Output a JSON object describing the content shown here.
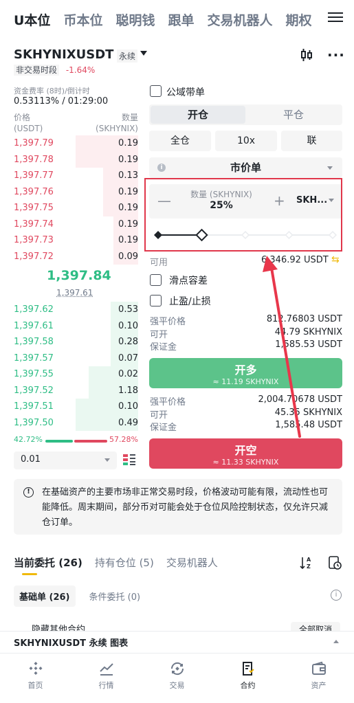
{
  "top_nav": {
    "tabs": [
      "U本位",
      "币本位",
      "聪明钱",
      "跟单",
      "交易机器人",
      "期权"
    ],
    "active": 0
  },
  "header": {
    "symbol": "SKHYNIXUSDT",
    "tag": "永续",
    "session": "非交易时段",
    "change": "-1.64%"
  },
  "orderbook": {
    "funding_label": "资金费率 (8时)/倒计时",
    "funding_value": "0.53113% / 01:29:00",
    "price_header": "价格",
    "price_unit": "(USDT)",
    "qty_header": "数量",
    "qty_unit": "(SKHYNIX)",
    "asks": [
      {
        "price": "1,397.79",
        "qty": "0.19",
        "depth": 0.5
      },
      {
        "price": "1,397.78",
        "qty": "0.19",
        "depth": 0.5
      },
      {
        "price": "1,397.77",
        "qty": "0.13",
        "depth": 0.28
      },
      {
        "price": "1,397.76",
        "qty": "0.19",
        "depth": 0.28
      },
      {
        "price": "1,397.75",
        "qty": "0.19",
        "depth": 0.28
      },
      {
        "price": "1,397.74",
        "qty": "0.19",
        "depth": 0.2
      },
      {
        "price": "1,397.73",
        "qty": "0.19",
        "depth": 0.2
      },
      {
        "price": "1,397.72",
        "qty": "0.09",
        "depth": 0.2
      }
    ],
    "last_price": "1,397.84",
    "mark_price": "1,397.61",
    "bids": [
      {
        "price": "1,397.62",
        "qty": "0.53",
        "depth": 0.22
      },
      {
        "price": "1,397.61",
        "qty": "0.10",
        "depth": 0.22
      },
      {
        "price": "1,397.58",
        "qty": "0.28",
        "depth": 0.22
      },
      {
        "price": "1,397.57",
        "qty": "0.07",
        "depth": 0.22
      },
      {
        "price": "1,397.55",
        "qty": "0.02",
        "depth": 0.4
      },
      {
        "price": "1,397.52",
        "qty": "1.18",
        "depth": 0.4
      },
      {
        "price": "1,397.51",
        "qty": "0.10",
        "depth": 0.5
      },
      {
        "price": "1,397.50",
        "qty": "0.49",
        "depth": 0.5
      }
    ],
    "buy_ratio": "42.72%",
    "sell_ratio": "57.28%",
    "depth_step": "0.01"
  },
  "form": {
    "public_copy_label": "公域带单",
    "open_label": "开仓",
    "close_label": "平仓",
    "margin_mode": "全仓",
    "leverage": "10x",
    "position_mode": "联",
    "order_type": "市价单",
    "qty_label": "数量 (SKHYNIX)",
    "qty_value": "25%",
    "qty_unit": "SKH...",
    "slider_percent": 25,
    "available_label": "可用",
    "available_value": "6,346.92 USDT",
    "slippage_label": "滑点容差",
    "tpsl_label": "止盈/止损",
    "long_info": {
      "liq_label": "强平价格",
      "liq_value": "812.76803 USDT",
      "open_label": "可开",
      "open_value": "44.79 SKHYNIX",
      "margin_label": "保证金",
      "margin_value": "1,585.53 USDT"
    },
    "long_button": {
      "title": "开多",
      "sub": "≈ 11.19 SKHYNIX"
    },
    "short_info": {
      "liq_label": "强平价格",
      "liq_value": "2,004.70678 USDT",
      "open_label": "可开",
      "open_value": "45.35 SKHYNIX",
      "margin_label": "保证金",
      "margin_value": "1,585.48 USDT"
    },
    "short_button": {
      "title": "开空",
      "sub": "≈ 11.33 SKHYNIX"
    }
  },
  "notice": "在基础资产的主要市场非正常交易时段，价格波动可能有限，流动性也可能降低。周末期间，部分币对可能会处于仓位风险控制状态，仅允许只减仓订单。",
  "orders": {
    "tabs": [
      "当前委托 (26)",
      "持有仓位 (5)",
      "交易机器人"
    ],
    "subtabs": [
      "基础单 (26)",
      "条件委托 (0)"
    ],
    "peek_text": "隐藏其他合约",
    "peek_button": "全部取消"
  },
  "chart_bar": "SKHYNIXUSDT 永续 图表",
  "bottom_nav": [
    "首页",
    "行情",
    "交易",
    "合约",
    "资产"
  ],
  "colors": {
    "buy": "#2ebd85",
    "sell": "#e0485f",
    "accent": "#f0b90b",
    "highlight": "#e0364a"
  }
}
